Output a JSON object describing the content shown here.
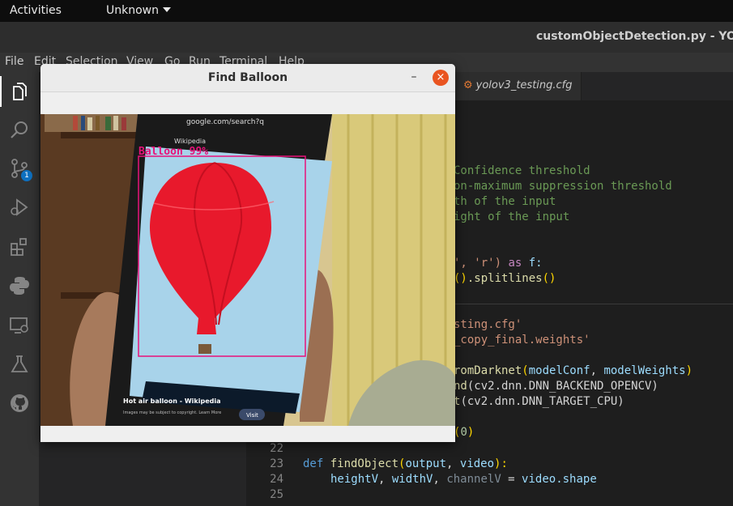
{
  "topbar": {
    "activities": "Activities",
    "app_menu": "Unknown"
  },
  "vscode": {
    "title": "customObjectDetection.py - YOLO",
    "menu": [
      "File",
      "Edit",
      "Selection",
      "View",
      "Go",
      "Run",
      "Terminal",
      "Help"
    ],
    "tab_label": "yolov3_testing.cfg",
    "scm_badge": "1",
    "icons": [
      "explorer-icon",
      "search-icon",
      "source-control-icon",
      "run-debug-icon",
      "extensions-icon",
      "python-icon",
      "remote-explorer-icon",
      "testing-icon",
      "github-icon"
    ]
  },
  "code": {
    "l1": "Confidence threshold",
    "l2": "on-maximum suppression threshold",
    "l3": "th of the input",
    "l4": "ight of the input",
    "l5a": "', 'r')",
    "l5b": " as ",
    "l5c": "f:",
    "l6a": "()",
    "l6b": ".splitlines",
    "l6c": "()",
    "l7": "sting.cfg'",
    "l8": "_copy_final.weights'",
    "l9a": "romDarknet",
    "l9b": "(",
    "l9c": "modelConf",
    "l9d": ", ",
    "l9e": "modelWeights",
    "l9f": ")",
    "l10a": "nd",
    "l10b": "(cv2.dnn.DNN_BACKEND_OPENCV)",
    "l11a": "t",
    "l11b": "(cv2.dnn.DNN_TARGET_CPU)",
    "l12a": "(",
    "l12b": "0",
    "l12c": ")",
    "n22": "22",
    "n23": "23",
    "l23a": "def ",
    "l23b": "findObject",
    "l23c": "(",
    "l23d": "output",
    "l23e": ", ",
    "l23f": "video",
    "l23g": "):",
    "n24": "24",
    "l24a": "heightV",
    "l24b": ", ",
    "l24c": "widthV",
    "l24d": ", ",
    "l24e": "channelV",
    "l24f": " = ",
    "l24g": "video",
    "l24h": ".shape",
    "n25": "25"
  },
  "popup": {
    "title": "Find Balloon",
    "min_label": "–",
    "close_label": "×",
    "detection_label": "Balloon 99%",
    "phone_url": "google.com/search?q",
    "phone_site": "Wikipedia",
    "phone_caption": "Hot air balloon - Wikipedia",
    "phone_subcaption": "Images may be subject to copyright. Learn More",
    "phone_visit": "Visit",
    "colors": {
      "detection_box": "#e8127a",
      "balloon": "#e8192c",
      "sky": "#a8d3ea",
      "close_button": "#e95420"
    }
  }
}
